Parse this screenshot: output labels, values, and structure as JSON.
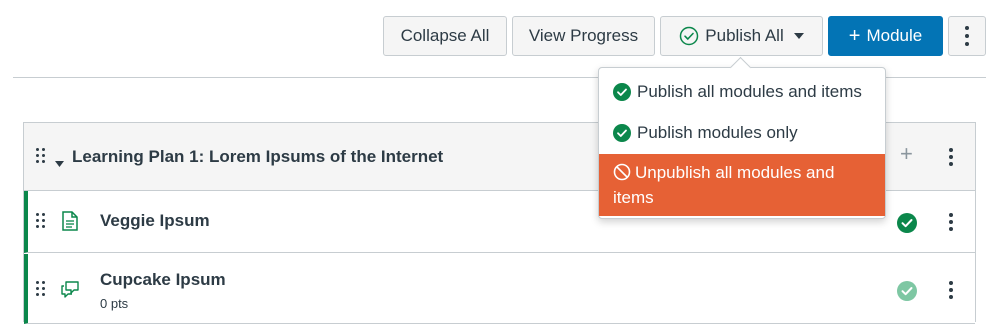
{
  "toolbar": {
    "collapse_all": "Collapse All",
    "view_progress": "View Progress",
    "publish_all": "Publish All",
    "add_module": "Module"
  },
  "publish_menu": {
    "items": [
      {
        "label": "Publish all modules and items",
        "icon": "check-circle-icon"
      },
      {
        "label": "Publish modules only",
        "icon": "check-circle-icon"
      },
      {
        "label": "Unpublish all modules and items",
        "icon": "no-entry-icon"
      }
    ]
  },
  "module": {
    "title": "Learning Plan 1: Lorem Ipsums of the Internet",
    "items": [
      {
        "title": "Veggie Ipsum",
        "subtitle": "",
        "icon": "document-icon",
        "published": true
      },
      {
        "title": "Cupcake Ipsum",
        "subtitle": "0 pts",
        "icon": "discussion-icon",
        "published": true
      }
    ]
  },
  "colors": {
    "accent": "#0374b5",
    "published": "#0b874b",
    "danger": "#e66135"
  }
}
